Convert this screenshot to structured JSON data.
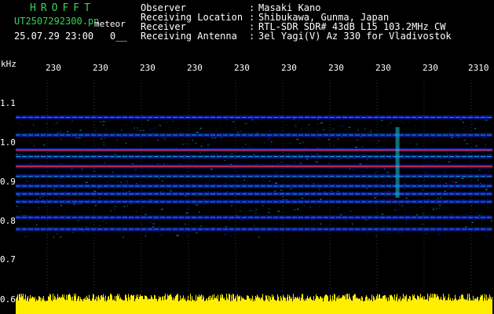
{
  "header": {
    "brand": "HROFFT",
    "filename": "UT2507292300.pn",
    "meteor_tag": "meteor",
    "datetime": "25.07.29 23:00",
    "mode": "0__",
    "fields": [
      {
        "label": "Observer",
        "value": "Masaki Kano"
      },
      {
        "label": "Receiving Location",
        "value": "Shibukawa, Gunma, Japan"
      },
      {
        "label": "Receiver",
        "value": "RTL-SDR SDR# 43dB L15 103.2MHz CW"
      },
      {
        "label": "Receiving Antenna",
        "value": "3el Yagi(V) Az 330 for Vladivostok"
      }
    ]
  },
  "axis": {
    "unit": "kHz",
    "y_ticks": [
      "1.1",
      "1.0",
      "0.9",
      "0.8",
      "0.7",
      "0.6"
    ],
    "x_ticks": [
      "230",
      "230",
      "230",
      "230",
      "230",
      "230",
      "230",
      "230",
      "230",
      "2310"
    ]
  },
  "colors": {
    "background": "#000000",
    "text": "#ffffff",
    "brand": "#35d35a",
    "signal_low": "#0a1aa8",
    "signal_mid": "#19c9e0",
    "signal_high": "#ff3030",
    "grid": "#7f7f7f",
    "amplitude": "#ffee00"
  },
  "chart_data": {
    "type": "heatmap",
    "y_unit": "kHz",
    "y_range": [
      0.6,
      1.14
    ],
    "x_range_minutes": [
      0,
      10
    ],
    "horizontal_signal_bands_khz": [
      {
        "f": 1.045,
        "intensity": 0.35
      },
      {
        "f": 1.0,
        "intensity": 0.45
      },
      {
        "f": 0.962,
        "intensity": 0.95
      },
      {
        "f": 0.945,
        "intensity": 0.55
      },
      {
        "f": 0.92,
        "intensity": 0.85
      },
      {
        "f": 0.895,
        "intensity": 0.4
      },
      {
        "f": 0.87,
        "intensity": 0.5
      },
      {
        "f": 0.85,
        "intensity": 0.55
      },
      {
        "f": 0.83,
        "intensity": 0.4
      },
      {
        "f": 0.79,
        "intensity": 0.45
      },
      {
        "f": 0.76,
        "intensity": 0.35
      }
    ],
    "vertical_bursts_minutes": [
      8.0
    ]
  }
}
